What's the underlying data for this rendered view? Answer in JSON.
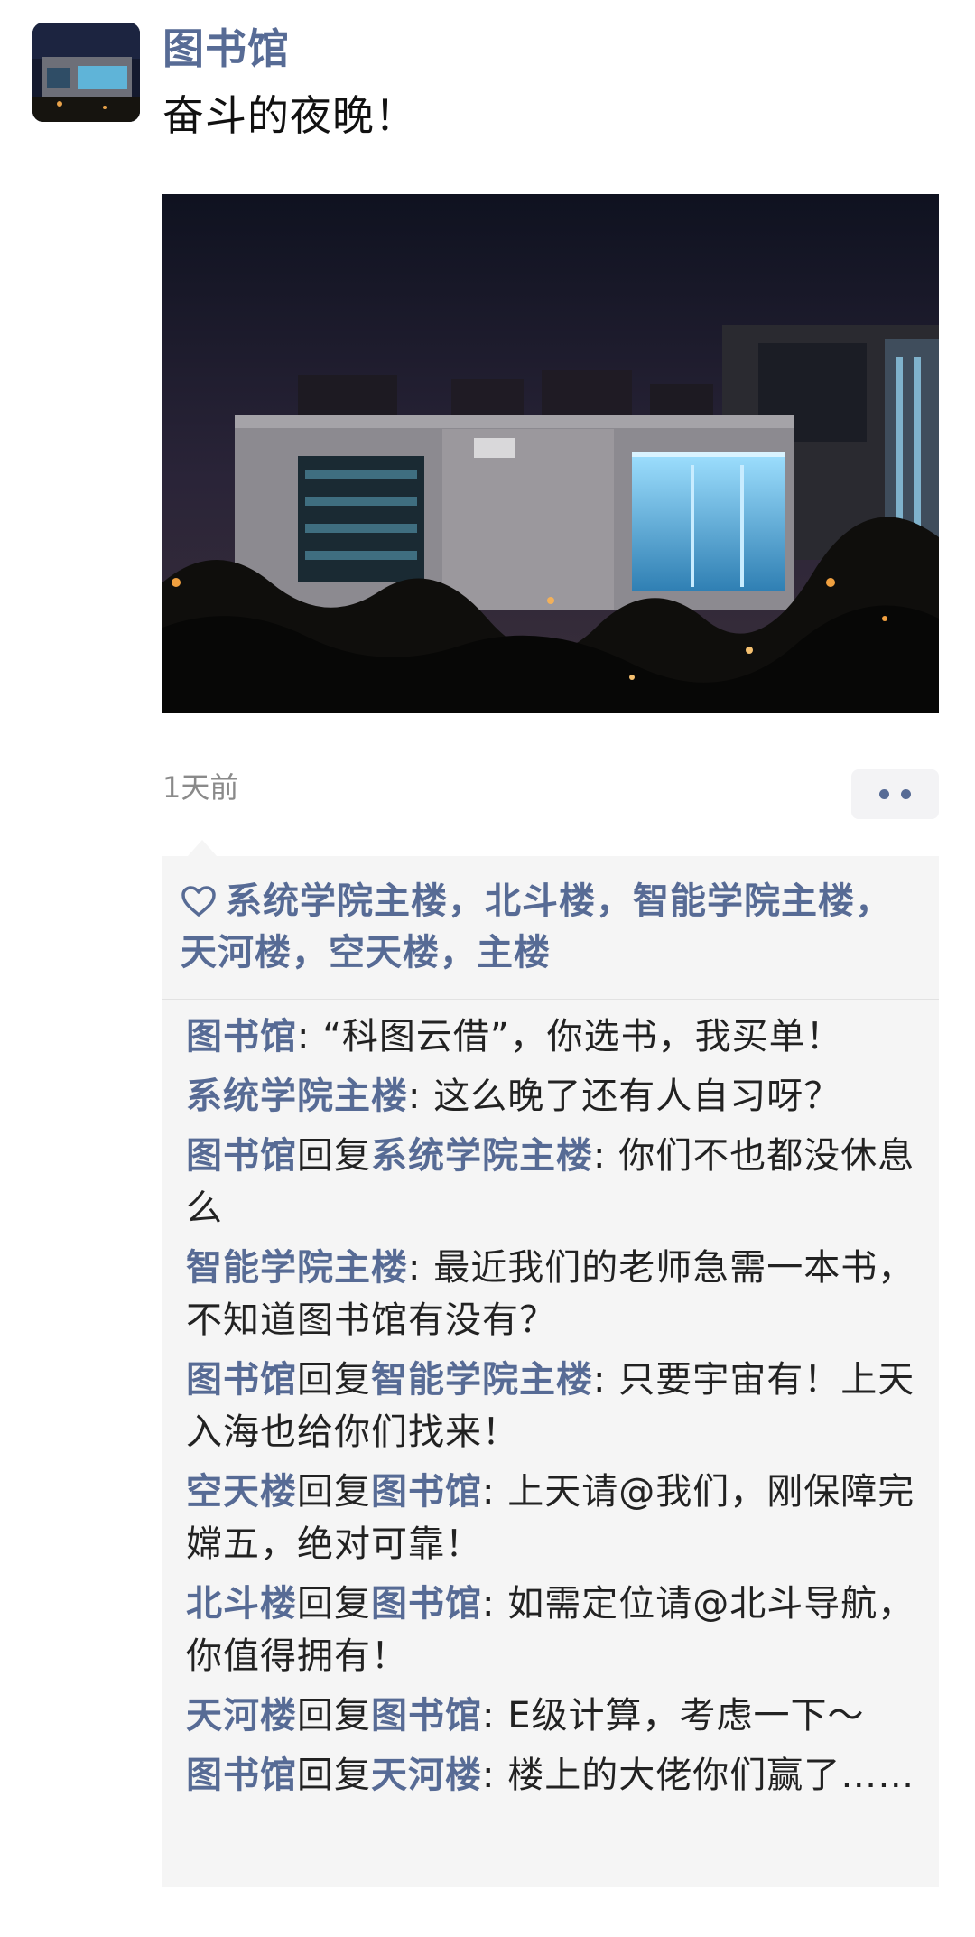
{
  "post": {
    "author": "图书馆",
    "text": "奋斗的夜晚！",
    "time": "1天前"
  },
  "likes": {
    "icon": "heart-icon",
    "names": "系统学院主楼，北斗楼，智能学院主楼，天河楼，空天楼，主楼"
  },
  "comments": [
    {
      "from": "图书馆",
      "reply_word": "",
      "to": "",
      "text": ": “科图云借”，你选书，我买单！"
    },
    {
      "from": "系统学院主楼",
      "reply_word": "",
      "to": "",
      "text": ": 这么晚了还有人自习呀？"
    },
    {
      "from": "图书馆",
      "reply_word": "回复",
      "to": "系统学院主楼",
      "text": ": 你们不也都没休息么"
    },
    {
      "from": "智能学院主楼",
      "reply_word": "",
      "to": "",
      "text": ": 最近我们的老师急需一本书，不知道图书馆有没有？"
    },
    {
      "from": "图书馆",
      "reply_word": "回复",
      "to": "智能学院主楼",
      "text": ": 只要宇宙有！上天入海也给你们找来！"
    },
    {
      "from": "空天楼",
      "reply_word": "回复",
      "to": "图书馆",
      "text": ": 上天请@我们，刚保障完嫦五，绝对可靠！"
    },
    {
      "from": "北斗楼",
      "reply_word": "回复",
      "to": "图书馆",
      "text": ": 如需定位请@北斗导航，你值得拥有！"
    },
    {
      "from": "天河楼",
      "reply_word": "回复",
      "to": "图书馆",
      "text": ": E级计算，考虑一下～"
    },
    {
      "from": "图书馆",
      "reply_word": "回复",
      "to": "天河楼",
      "text": ": 楼上的大佬你们赢了……"
    }
  ],
  "colors": {
    "link": "#576b95",
    "panel": "#f5f5f5",
    "time": "#8a8a8a"
  }
}
